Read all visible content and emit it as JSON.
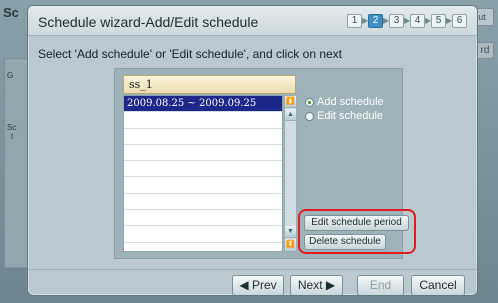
{
  "background": {
    "title_fragment": "Sc",
    "top_right_button": "ut",
    "side_button": "rd",
    "left_labels": [
      "G",
      "Sc",
      "t"
    ]
  },
  "dialog": {
    "title": "Schedule wizard-Add/Edit schedule",
    "steps": [
      "1",
      "2",
      "3",
      "4",
      "5",
      "6"
    ],
    "active_step": "2",
    "instruction": "Select 'Add schedule' or 'Edit schedule', and click on next",
    "schedule_name": "ss_1",
    "list": {
      "rows": [
        "2009.08.25 ~ 2009.09.25",
        "",
        "",
        "",
        "",
        "",
        "",
        "",
        "",
        ""
      ],
      "selected_index": 0
    },
    "options": {
      "add_schedule": "Add schedule",
      "edit_schedule": "Edit schedule",
      "selected": "add_schedule"
    },
    "buttons": {
      "edit_period": "Edit schedule period",
      "delete_schedule": "Delete schedule"
    },
    "footer": {
      "prev": "◀ Prev",
      "next": "Next ▶",
      "end": "End",
      "cancel": "Cancel"
    },
    "colors": {
      "selection": "#1d2689",
      "highlight": "#e01d1d",
      "active_step": "#3f8fc5"
    }
  }
}
